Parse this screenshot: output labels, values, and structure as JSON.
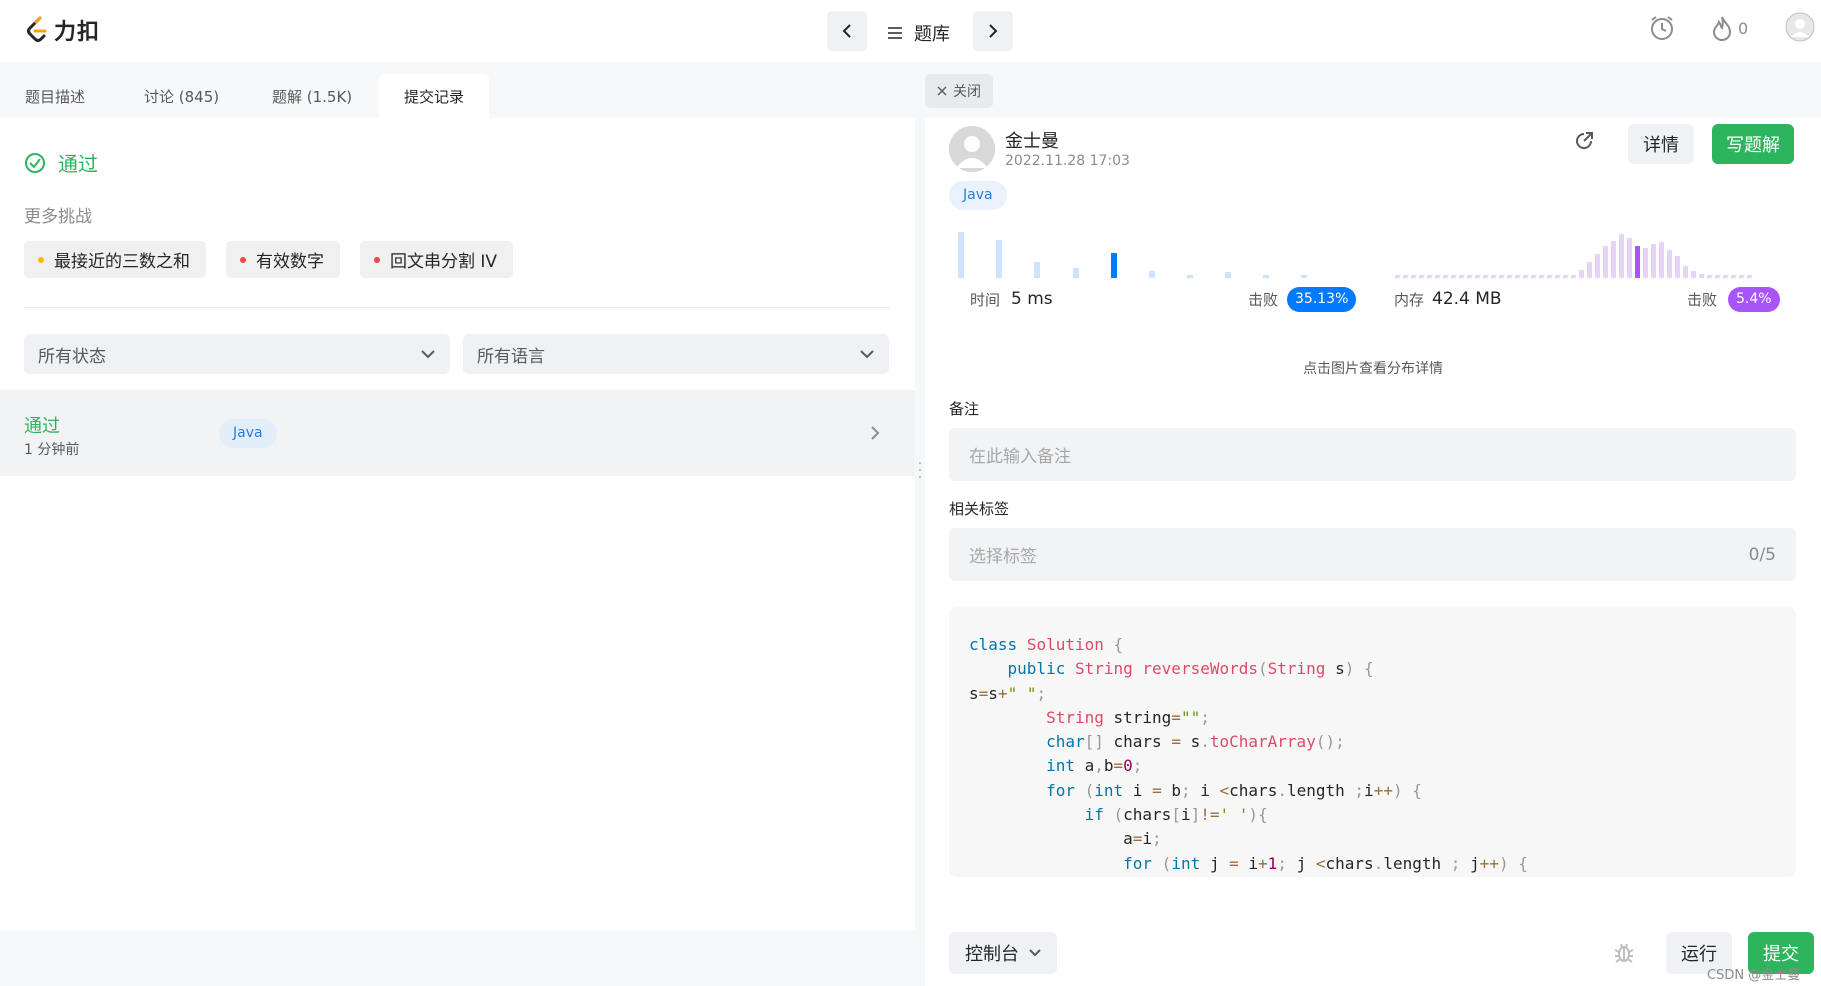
{
  "topbar": {
    "logo_text": "力扣",
    "bank_label": "题库",
    "flame_count": "0"
  },
  "tabs": [
    {
      "label": "题目描述"
    },
    {
      "label": "讨论 (845)"
    },
    {
      "label": "题解 (1.5K)"
    },
    {
      "label": "提交记录"
    }
  ],
  "result": {
    "status": "通过",
    "more_label": "更多挑战",
    "chips": [
      {
        "label": "最接近的三数之和",
        "color": "#ffb800"
      },
      {
        "label": "有效数字",
        "color": "#ef4743"
      },
      {
        "label": "回文串分割 IV",
        "color": "#ef4743"
      }
    ]
  },
  "filters": {
    "status_select": "所有状态",
    "lang_select": "所有语言"
  },
  "submission_row": {
    "status": "通过",
    "time": "1 分钟前",
    "lang": "Java"
  },
  "detail": {
    "close_label": "关闭",
    "user_name": "金士曼",
    "date": "2022.11.28 17:03",
    "detail_button": "详情",
    "write_button": "写题解",
    "lang": "Java",
    "time_label": "时间",
    "time_value": "5 ms",
    "time_beat_label": "击败",
    "time_beat": "35.13%",
    "mem_label": "内存",
    "mem_value": "42.4 MB",
    "mem_beat_label": "击败",
    "mem_beat": "5.4%",
    "hint": "点击图片查看分布详情",
    "note_label": "备注",
    "note_placeholder": "在此输入备注",
    "tags_label": "相关标签",
    "tags_placeholder": "选择标签",
    "tags_count": "0/5"
  },
  "code_lines": [
    "class Solution {",
    "    public String reverseWords(String s) {",
    "s=s+\" \";",
    "        String string=\"\";",
    "        char[] chars = s.toCharArray();",
    "        int a,b=0;",
    "        for (int i = b; i <chars.length ;i++) {",
    "            if (chars[i]!=' '){",
    "                a=i;",
    "                for (int j = i+1; j <chars.length ; j++) {"
  ],
  "bottom": {
    "console_label": "控制台",
    "run_label": "运行",
    "submit_label": "提交",
    "watermark": "CSDN @金士曼"
  },
  "colors": {
    "green": "#2db55d",
    "blue_accent": "#007aff",
    "purple_accent": "#a855f7"
  }
}
